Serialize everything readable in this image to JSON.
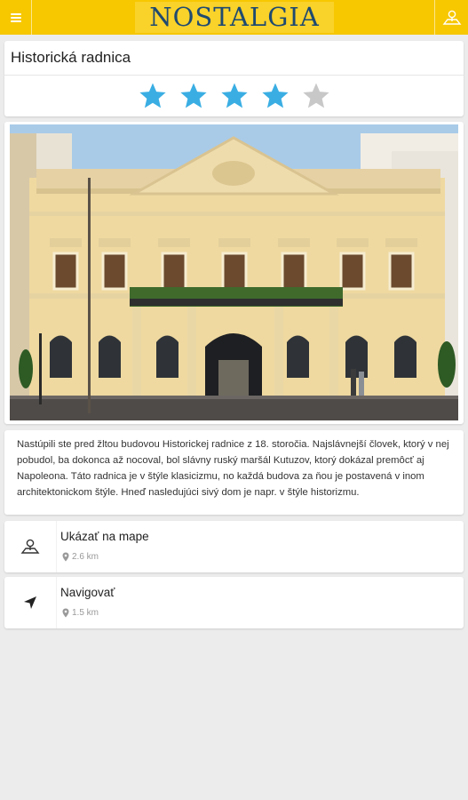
{
  "header": {
    "menu_icon": "hamburger-menu-icon",
    "logo_text": "NOSTALGIA",
    "map_icon": "map-marker-icon",
    "bg_color": "#f7c700",
    "logo_color": "#1f4a70"
  },
  "place": {
    "title": "Historická radnica",
    "rating": 4,
    "rating_max": 5,
    "star_filled_color": "#3aaee3",
    "star_empty_color": "#c8c8c8"
  },
  "photo": {
    "subject": "Historická radnica"
  },
  "description": "Nastúpili ste pred žltou budovou Historickej radnice z 18. storočia. Najslávnejší človek, ktorý v nej pobudol, ba dokonca až nocoval, bol slávny ruský maršál Kutuzov, ktorý dokázal premôcť aj Napoleona. Táto radnica je v štýle klasicizmu, no každá budova za ňou je postavená v inom architektonickom  štýle. Hneď nasledujúci sivý dom je napr. v štýle historizmu.",
  "actions": {
    "show_on_map": {
      "label": "Ukázať na mape",
      "distance": "2.6 km",
      "icon": "map-pin-icon"
    },
    "navigate": {
      "label": "Navigovať",
      "distance": "1.5 km",
      "icon": "navigation-arrow-icon"
    }
  }
}
